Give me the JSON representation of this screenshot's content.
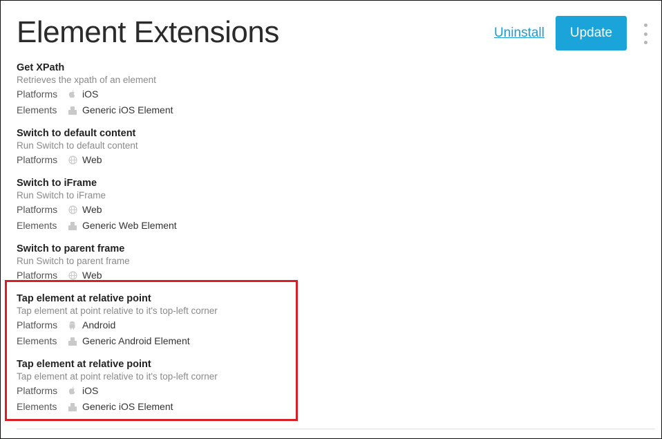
{
  "header": {
    "title": "Element Extensions",
    "uninstall_label": "Uninstall",
    "update_label": "Update"
  },
  "extensions": [
    {
      "name": "Get XPath",
      "description": "Retrieves the xpath of an element",
      "platforms_label": "Platforms",
      "platform": "iOS",
      "platform_icon": "apple-icon",
      "elements_label": "Elements",
      "element": "Generic iOS Element"
    },
    {
      "name": "Switch to default content",
      "description": "Run Switch to default content",
      "platforms_label": "Platforms",
      "platform": "Web",
      "platform_icon": "globe-icon"
    },
    {
      "name": "Switch to iFrame",
      "description": "Run Switch to iFrame",
      "platforms_label": "Platforms",
      "platform": "Web",
      "platform_icon": "globe-icon",
      "elements_label": "Elements",
      "element": "Generic Web Element"
    },
    {
      "name": "Switch to parent frame",
      "description": "Run Switch to parent frame",
      "platforms_label": "Platforms",
      "platform": "Web",
      "platform_icon": "globe-icon"
    },
    {
      "name": "Tap element at relative point",
      "description": "Tap element at point relative to it's top-left corner",
      "platforms_label": "Platforms",
      "platform": "Android",
      "platform_icon": "android-icon",
      "elements_label": "Elements",
      "element": "Generic Android Element"
    },
    {
      "name": "Tap element at relative point",
      "description": "Tap element at point relative to it's top-left corner",
      "platforms_label": "Platforms",
      "platform": "iOS",
      "platform_icon": "apple-icon",
      "elements_label": "Elements",
      "element": "Generic iOS Element"
    }
  ],
  "colors": {
    "accent": "#1aa4d9",
    "link": "#1a9bd7",
    "highlight": "#d91e26"
  }
}
